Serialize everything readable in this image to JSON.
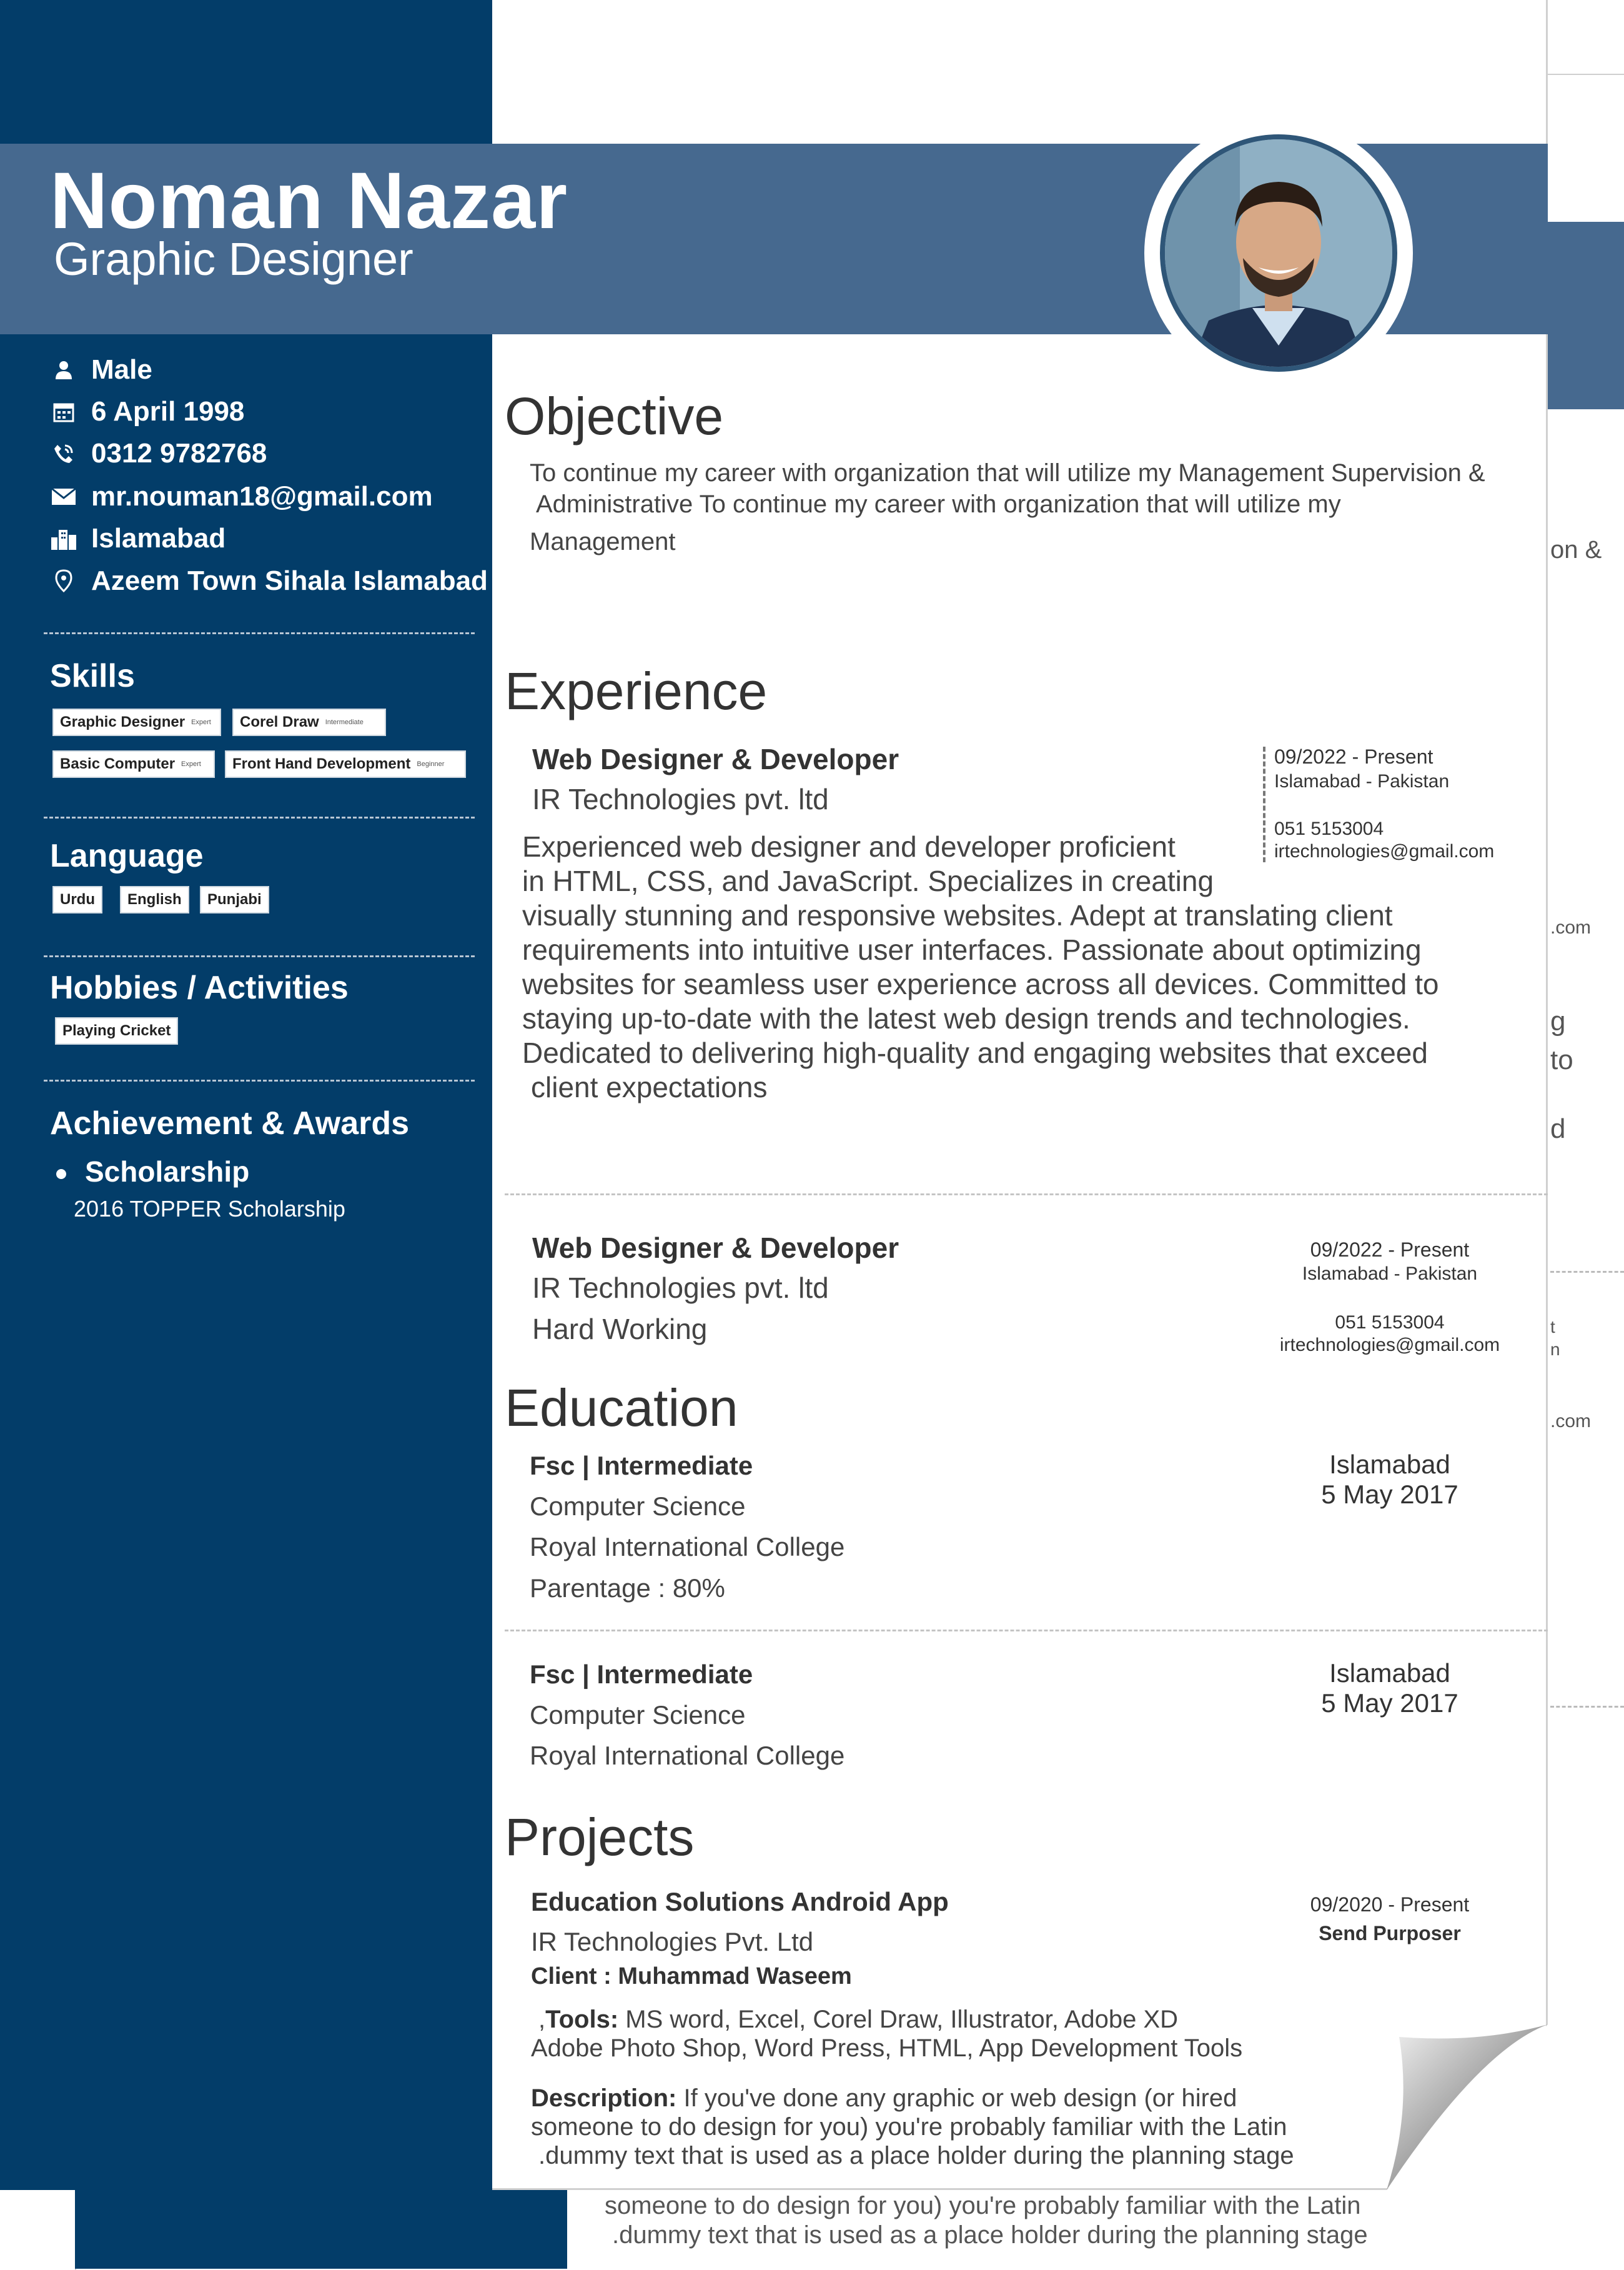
{
  "profile": {
    "name": "Noman Nazar",
    "title": "Graphic Designer"
  },
  "contact": {
    "gender": "Male",
    "dob": "6 April 1998",
    "phone": "0312 9782768",
    "email": "mr.nouman18@gmail.com",
    "city": "Islamabad",
    "address": "Azeem Town Sihala Islamabad"
  },
  "icons": [
    "person-icon",
    "calendar-icon",
    "phone-icon",
    "mail-icon",
    "city-icon",
    "location-pin-icon"
  ],
  "skills": {
    "heading": "Skills",
    "items": [
      {
        "name": "Graphic Designer",
        "level": "Expert"
      },
      {
        "name": "Corel Draw",
        "level": "Intermediate"
      },
      {
        "name": "Basic Computer",
        "level": "Expert"
      },
      {
        "name": "Front Hand Development",
        "level": "Beginner"
      }
    ]
  },
  "language": {
    "heading": "Language",
    "items": [
      "Urdu",
      "English",
      "Punjabi"
    ]
  },
  "hobbies": {
    "heading": "Hobbies / Activities",
    "items": [
      "Playing Cricket"
    ]
  },
  "awards": {
    "heading": "Achievement & Awards",
    "items": [
      {
        "title": "Scholarship",
        "detail": "2016 TOPPER Scholarship"
      }
    ]
  },
  "objective": {
    "heading": "Objective",
    "lines": [
      "To continue my career with organization that will utilize my Management Supervision &",
      "Administrative To continue my career with organization that will utilize my",
      "Management"
    ]
  },
  "experience": {
    "heading": "Experience",
    "items": [
      {
        "title": "Web Designer & Developer",
        "company": "IR Technologies pvt. ltd",
        "period": "09/2022 - Present",
        "location": "Islamabad - Pakistan",
        "phone": "051 5153004",
        "email": "irtechnologies@gmail.com",
        "description": [
          "Experienced web designer and developer proficient",
          "in HTML, CSS, and JavaScript. Specializes in creating",
          "visually stunning and responsive websites. Adept at translating client",
          "requirements into intuitive user interfaces. Passionate about optimizing",
          "websites for seamless user experience across all devices. Committed to",
          "staying up-to-date with the latest web design trends and technologies.",
          "Dedicated to delivering high-quality and engaging websites that exceed",
          "client expectations"
        ]
      },
      {
        "title": "Web Designer & Developer",
        "company": "IR Technologies pvt. ltd",
        "note": "Hard Working",
        "period": "09/2022 - Present",
        "location": "Islamabad - Pakistan",
        "phone": "051 5153004",
        "email": "irtechnologies@gmail.com"
      }
    ]
  },
  "education": {
    "heading": "Education",
    "items": [
      {
        "degree": "Fsc | Intermediate",
        "field": "Computer Science",
        "institute": "Royal International College",
        "grade": "Parentage : 80%",
        "city": "Islamabad",
        "date": "5 May 2017"
      },
      {
        "degree": "Fsc | Intermediate",
        "field": "Computer Science",
        "institute": "Royal International College",
        "city": "Islamabad",
        "date": "5 May 2017"
      }
    ]
  },
  "projects": {
    "heading": "Projects",
    "items": [
      {
        "name": "Education Solutions Android App",
        "company": "IR Technologies Pvt. Ltd",
        "client": "Client : Muhammad Waseem",
        "period": "09/2020 - Present",
        "status": "Send Purposer",
        "tools_label": "Tools:",
        "tools_prefix": ",",
        "tools_line1": "MS word, Excel, Corel Draw, Illustrator, Adobe XD",
        "tools_line2": "Adobe Photo Shop, Word Press, HTML, App Development Tools",
        "description_label": "Description:",
        "description_line1": "If you've done any graphic or web design (or hired",
        "description_line2": "someone to do design for you) you're probably familiar with the Latin",
        "description_line3": ".dummy text that is used as a place holder during the planning stage"
      }
    ]
  },
  "back_page": {
    "fragments": [
      "on &",
      ".com",
      "g",
      "to",
      "d",
      "t",
      "n",
      ".com"
    ],
    "line1": "someone to do design for you) you're probably familiar with the Latin",
    "line2": ".dummy text that is used as a place holder during the planning stage"
  },
  "colors": {
    "sidebar": "#033d69",
    "header_band": "#46698f",
    "photo_border": "#2f5678"
  }
}
